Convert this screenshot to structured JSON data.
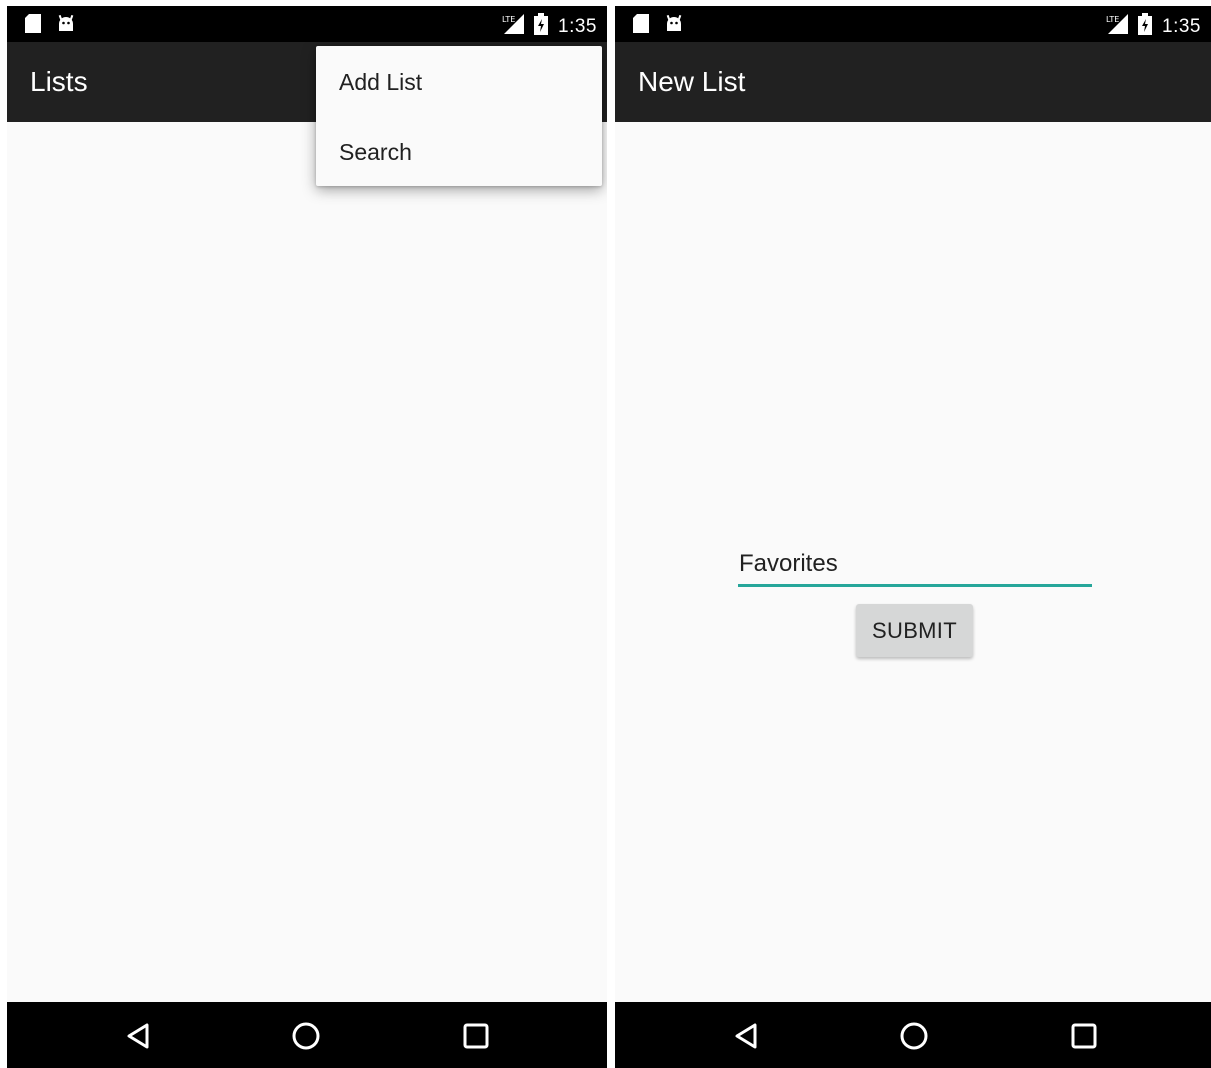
{
  "left_screen": {
    "status_bar": {
      "time": "1:35",
      "icons": [
        "sd-card-icon",
        "android-icon",
        "lte-signal-icon",
        "battery-charging-icon"
      ]
    },
    "app_bar": {
      "title": "Lists"
    },
    "overflow_menu": {
      "items": [
        {
          "label": "Add List"
        },
        {
          "label": "Search"
        }
      ]
    },
    "nav_bar": {
      "buttons": [
        "back-icon",
        "home-icon",
        "recents-icon"
      ]
    }
  },
  "right_screen": {
    "status_bar": {
      "time": "1:35",
      "icons": [
        "sd-card-icon",
        "android-icon",
        "lte-signal-icon",
        "battery-charging-icon"
      ]
    },
    "app_bar": {
      "title": "New List"
    },
    "form": {
      "list_name_value": "Favorites",
      "submit_label": "SUBMIT"
    },
    "nav_bar": {
      "buttons": [
        "back-icon",
        "home-icon",
        "recents-icon"
      ]
    }
  },
  "colors": {
    "status_bar": "#000000",
    "app_bar": "#212121",
    "background": "#fafafa",
    "accent": "#26a69a",
    "button": "#d6d7d7"
  }
}
